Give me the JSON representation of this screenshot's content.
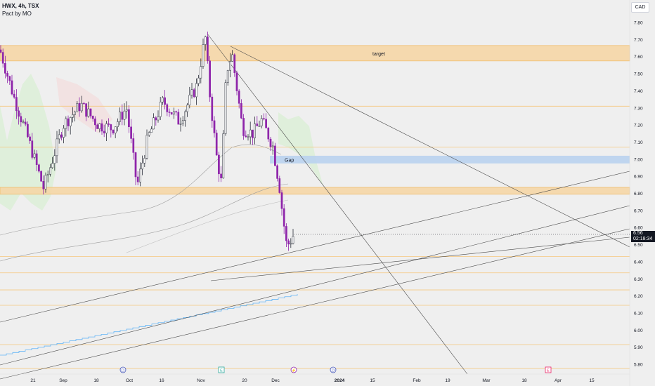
{
  "header": {
    "symbol": "HWX, 4h, TSX",
    "indicator": "Pact by MO",
    "currency": "CAD"
  },
  "price_badge": {
    "price": "6.56",
    "countdown": "02:18:34"
  },
  "colors": {
    "bull_candle": "#2a2e39",
    "bear_candle": "#8e24aa",
    "zone_fill": "#f6d7a8",
    "zone_border": "#f0b860",
    "gap_fill": "#b9d2ee",
    "level_line": "#f5c77e",
    "trend_line": "#4a4a4a",
    "step_line": "#64b5f6",
    "cloud": "#d9efd3"
  },
  "chart_data": {
    "type": "candlestick",
    "symbol": "HWX",
    "timeframe": "4h",
    "exchange": "TSX",
    "y_axis": {
      "range": [
        5.76,
        7.85
      ],
      "ticks": [
        "7.80",
        "7.70",
        "7.60",
        "7.50",
        "7.40",
        "7.30",
        "7.20",
        "7.10",
        "7.00",
        "6.90",
        "6.80",
        "6.70",
        "6.60",
        "6.50",
        "6.40",
        "6.30",
        "6.20",
        "6.10",
        "6.00",
        "5.90",
        "5.80"
      ]
    },
    "x_axis": {
      "ticks": [
        "21",
        "Sep",
        "18",
        "Oct",
        "16",
        "Nov",
        "20",
        "Dec",
        "2024",
        "15",
        "Feb",
        "19",
        "Mar",
        "18",
        "Apr",
        "15"
      ]
    },
    "zones": [
      {
        "label": "target",
        "low": 7.575,
        "high": 7.665
      },
      {
        "label": "",
        "low": 6.795,
        "high": 6.835
      },
      {
        "label": "Gap",
        "low": 6.975,
        "high": 7.02
      }
    ],
    "horizontal_levels": [
      7.31,
      7.07,
      6.43,
      6.335,
      6.235,
      6.145,
      5.915,
      5.775
    ],
    "event_markers": [
      "D",
      "E",
      "⚡",
      "D",
      "E"
    ],
    "last_price": 6.56
  }
}
